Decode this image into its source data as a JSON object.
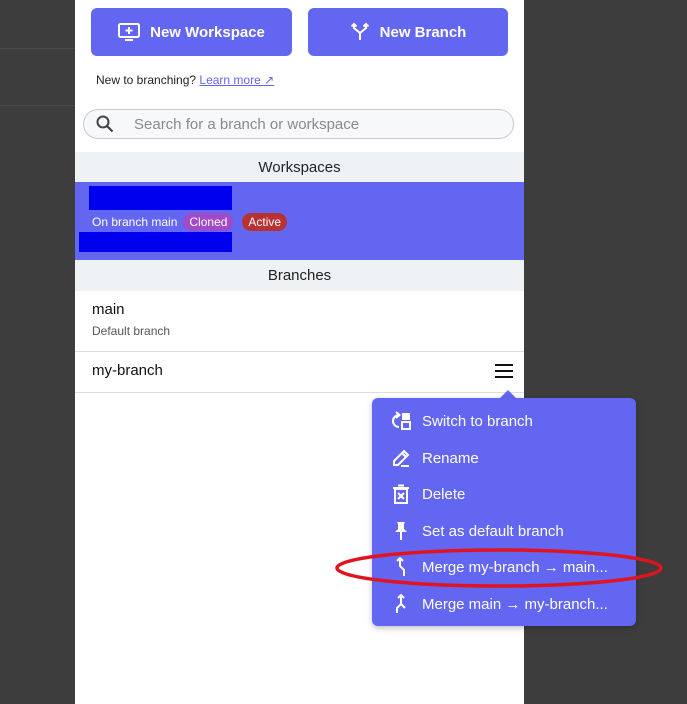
{
  "buttons": {
    "new_workspace": "New Workspace",
    "new_branch": "New Branch"
  },
  "hint": {
    "text": "New to branching?",
    "link": "Learn more ↗"
  },
  "search": {
    "placeholder": "Search for a branch or workspace"
  },
  "sections": {
    "workspaces": "Workspaces",
    "branches": "Branches"
  },
  "workspace": {
    "on_branch": "On branch main",
    "badges": [
      "Cloned",
      "Active"
    ]
  },
  "branches": [
    {
      "name": "main",
      "subtitle": "Default branch"
    },
    {
      "name": "my-branch",
      "subtitle": ""
    }
  ],
  "context_menu": {
    "items": [
      {
        "label": "Switch to branch",
        "icon": "switch-branch-icon"
      },
      {
        "label": "Rename",
        "icon": "pencil-icon"
      },
      {
        "label": "Delete",
        "icon": "trash-icon"
      },
      {
        "label": "Set as default branch",
        "icon": "pin-icon"
      },
      {
        "label": "Merge my-branch → main...",
        "icon": "merge-into-icon"
      },
      {
        "label": "Merge main → my-branch...",
        "icon": "merge-from-icon"
      }
    ]
  },
  "colors": {
    "accent": "#6366f1",
    "cloned_badge": "#a04ac8",
    "active_badge": "#b73232",
    "annotation": "#e0141e"
  }
}
